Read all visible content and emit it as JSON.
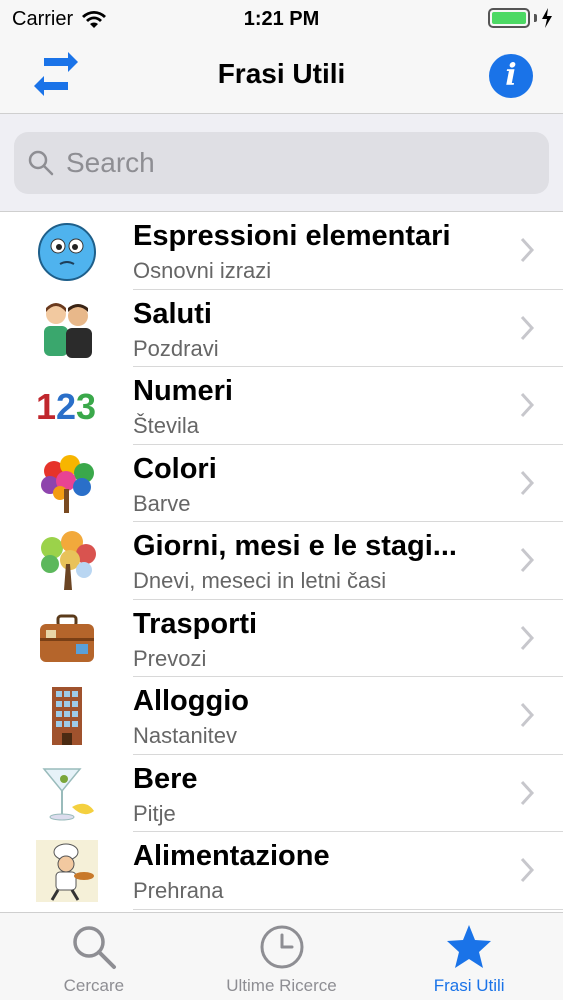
{
  "status_bar": {
    "carrier": "Carrier",
    "time": "1:21 PM"
  },
  "nav": {
    "title": "Frasi Utili"
  },
  "search": {
    "placeholder": "Search"
  },
  "list": [
    {
      "title": "Espressioni elementari",
      "subtitle": "Osnovni izrazi",
      "icon": "blue-face-icon"
    },
    {
      "title": "Saluti",
      "subtitle": "Pozdravi",
      "icon": "greeting-people-icon"
    },
    {
      "title": "Numeri",
      "subtitle": "Števila",
      "icon": "numbers-123-icon"
    },
    {
      "title": "Colori",
      "subtitle": "Barve",
      "icon": "colorful-tree-icon"
    },
    {
      "title": "Giorni, mesi e le stagi...",
      "subtitle": "Dnevi, meseci in letni časi",
      "icon": "seasons-tree-icon"
    },
    {
      "title": "Trasporti",
      "subtitle": "Prevozi",
      "icon": "suitcase-icon"
    },
    {
      "title": "Alloggio",
      "subtitle": "Nastanitev",
      "icon": "building-icon"
    },
    {
      "title": "Bere",
      "subtitle": "Pitje",
      "icon": "martini-icon"
    },
    {
      "title": "Alimentazione",
      "subtitle": "Prehrana",
      "icon": "chef-icon"
    }
  ],
  "tabs": [
    {
      "label": "Cercare",
      "icon": "magnifier-icon",
      "active": false
    },
    {
      "label": "Ultime Ricerce",
      "icon": "clock-icon",
      "active": false
    },
    {
      "label": "Frasi Utili",
      "icon": "star-icon",
      "active": true
    }
  ],
  "colors": {
    "accent": "#1a73e8",
    "battery": "#4cd964",
    "inactive": "#8e8e93"
  }
}
